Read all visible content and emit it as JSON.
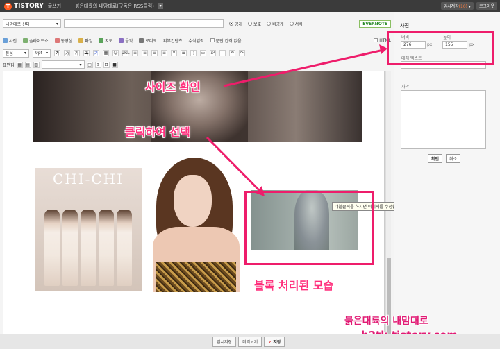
{
  "topbar": {
    "brand": "TISTORY",
    "brand_sub": "글쓰기",
    "blog_title": "붉은대륙의 내맘대로(구독은 RSS클릭)",
    "temp_save_label": "임시저장",
    "temp_save_count": "(10)",
    "logout_label": "로그아웃"
  },
  "toolbar": {
    "category": "내맘대로 산다",
    "title_value": "",
    "visibility": {
      "public": "공개",
      "protect": "보호",
      "private": "비공개",
      "draft": "서식"
    },
    "evernote": "EVERNOTE",
    "items": [
      "사진",
      "슬라이드쇼",
      "동영상",
      "파일",
      "지도",
      "음악",
      "로디오",
      "외부컨텐츠",
      "수식입력",
      "문단 간격 없음"
    ],
    "html_label": "HTML",
    "font": "돋움",
    "size": "9pt",
    "row3_buttons": [
      "가",
      "가",
      "가",
      "가",
      "가",
      "URL",
      "",
      "",
      "",
      "",
      "",
      ""
    ],
    "table_label": "표편집"
  },
  "selected_image_tooltip": "더블클릭을 하시면 이미지를 수정할 수 있습니다",
  "image_texts": {
    "chi_chi": "CHI-CHI"
  },
  "annotations": {
    "size_check": "사이즈 확인",
    "click_select": "클릭하여 선택",
    "block_processed": "블록 처리된 모습"
  },
  "watermark": {
    "line1": "붉은대륙의 내맘대로",
    "line2": "h2tk.tistory.com"
  },
  "bottom": {
    "temp_save": "임시저장",
    "preview": "미리보기",
    "save": "저장"
  },
  "panel": {
    "title": "사진",
    "width_label": "너비",
    "height_label": "높이",
    "width_value": "276",
    "height_value": "155",
    "px": "px",
    "alt_label": "대체 텍스트",
    "caption_label": "자막",
    "ok": "확인",
    "cancel": "취소"
  },
  "colors": {
    "accent": "#ee1d6b",
    "topbar": "#3b3b3b",
    "brand": "#ff5a1f"
  }
}
